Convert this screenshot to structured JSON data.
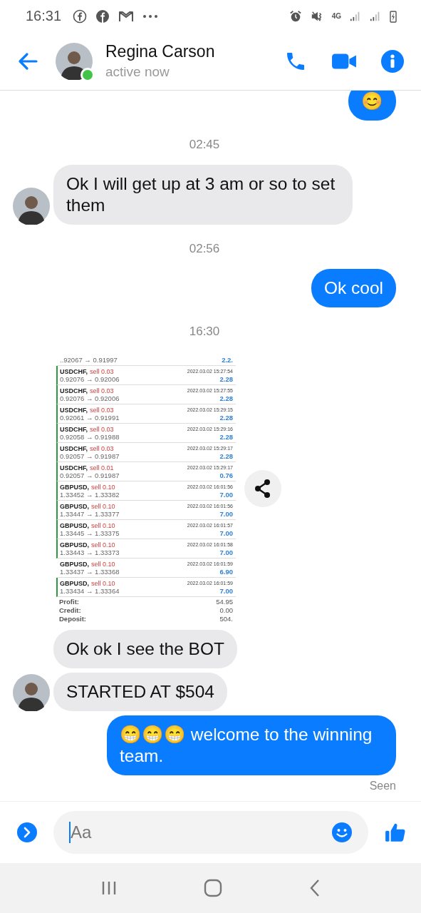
{
  "status_bar": {
    "time": "16:31",
    "network": "4G"
  },
  "contact": {
    "name": "Regina Carson",
    "status": "active now",
    "online": true
  },
  "messages": [
    {
      "kind": "outgoing",
      "text": "😊"
    },
    {
      "kind": "time",
      "text": "02:45"
    },
    {
      "kind": "incoming",
      "text": "Ok I will get up at 3 am or so to set them",
      "avatar": true
    },
    {
      "kind": "time",
      "text": "02:56"
    },
    {
      "kind": "outgoing",
      "text": "Ok cool"
    },
    {
      "kind": "time",
      "text": "16:30"
    },
    {
      "kind": "image",
      "avatar": false,
      "trades": [
        {
          "kind": "partial",
          "prices": "..92067 → 0.91997",
          "profit": "2.2.",
          "marked": false
        },
        {
          "kind": "trade",
          "symbol": "USDCHF,",
          "side": "sell 0.03",
          "time": "2022.03.02 15:27:54",
          "prices": "0.92076 → 0.92006",
          "profit": "2.28",
          "marked": true
        },
        {
          "kind": "trade",
          "symbol": "USDCHF,",
          "side": "sell 0.03",
          "time": "2022.03.02 15:27:55",
          "prices": "0.92076 → 0.92006",
          "profit": "2.28",
          "marked": true
        },
        {
          "kind": "trade",
          "symbol": "USDCHF,",
          "side": "sell 0.03",
          "time": "2022.03.02 15:29:15",
          "prices": "0.92061 → 0.91991",
          "profit": "2.28",
          "marked": true
        },
        {
          "kind": "trade",
          "symbol": "USDCHF,",
          "side": "sell 0.03",
          "time": "2022.03.02 15:29:16",
          "prices": "0.92058 → 0.91988",
          "profit": "2.28",
          "marked": true
        },
        {
          "kind": "trade",
          "symbol": "USDCHF,",
          "side": "sell 0.03",
          "time": "2022.03.02 15:29:17",
          "prices": "0.92057 → 0.91987",
          "profit": "2.28",
          "marked": true
        },
        {
          "kind": "trade",
          "symbol": "USDCHF,",
          "side": "sell 0.01",
          "time": "2022.03.02 15:29:17",
          "prices": "0.92057 → 0.91987",
          "profit": "0.76",
          "marked": true
        },
        {
          "kind": "trade",
          "symbol": "GBPUSD,",
          "side": "sell 0.10",
          "time": "2022.03.02 16:01:56",
          "prices": "1.33452 → 1.33382",
          "profit": "7.00",
          "marked": true
        },
        {
          "kind": "trade",
          "symbol": "GBPUSD,",
          "side": "sell 0.10",
          "time": "2022.03.02 16:01:56",
          "prices": "1.33447 → 1.33377",
          "profit": "7.00",
          "marked": true
        },
        {
          "kind": "trade",
          "symbol": "GBPUSD,",
          "side": "sell 0.10",
          "time": "2022.03.02 16:01:57",
          "prices": "1.33445 → 1.33375",
          "profit": "7.00",
          "marked": true
        },
        {
          "kind": "trade",
          "symbol": "GBPUSD,",
          "side": "sell 0.10",
          "time": "2022.03.02 16:01:58",
          "prices": "1.33443 → 1.33373",
          "profit": "7.00",
          "marked": true
        },
        {
          "kind": "trade",
          "symbol": "GBPUSD,",
          "side": "sell 0.10",
          "time": "2022.03.02 16:01:59",
          "prices": "1.33437 → 1.33368",
          "profit": "6.90",
          "marked": false
        },
        {
          "kind": "trade",
          "symbol": "GBPUSD,",
          "side": "sell 0.10",
          "time": "2022.03.02 16:01:59",
          "prices": "1.33434 → 1.33364",
          "profit": "7.00",
          "marked": true
        }
      ],
      "summary": [
        {
          "label": "Profit:",
          "value": "54.95"
        },
        {
          "label": "Credit:",
          "value": "0.00"
        },
        {
          "label": "Deposit:",
          "value": "504."
        }
      ]
    },
    {
      "kind": "incoming",
      "text": "Ok ok I see the BOT",
      "avatar": false
    },
    {
      "kind": "incoming",
      "text": "STARTED AT $504",
      "avatar": true
    },
    {
      "kind": "outgoing",
      "text": "😁😁😁 welcome to the winning team."
    },
    {
      "kind": "receipt",
      "text": "Seen"
    }
  ],
  "composer": {
    "placeholder": "Aa"
  }
}
